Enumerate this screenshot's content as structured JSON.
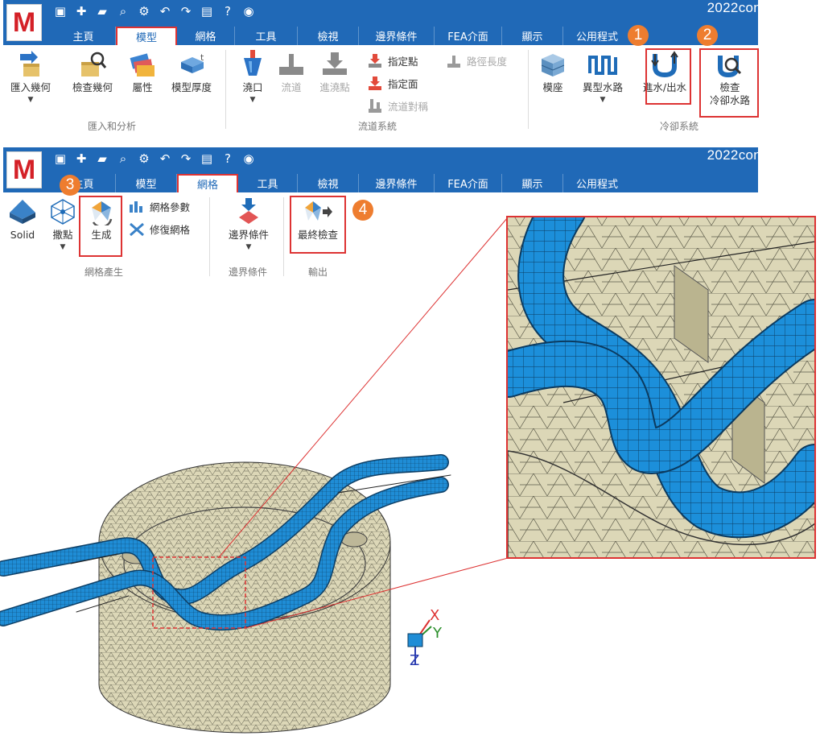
{
  "app": {
    "brand": "2022con",
    "logo_letter": "M"
  },
  "qat_icons": [
    "save-icon",
    "new-icon",
    "open-folder-icon",
    "search-file-icon",
    "gear-icon",
    "undo-icon",
    "redo-icon",
    "help-file-icon",
    "help-icon",
    "camera-icon"
  ],
  "ribbon1": {
    "tabs": [
      "主頁",
      "模型",
      "網格",
      "工具",
      "檢視",
      "邊界條件",
      "FEA介面",
      "顯示",
      "公用程式"
    ],
    "active_tab": "模型",
    "tools": {
      "import_geometry": "匯入幾何",
      "check_geometry": "檢查幾何",
      "attribute": "屬性",
      "model_thickness": "模型厚度",
      "gate": "澆口",
      "runner": "流道",
      "sprue": "進澆點",
      "assign_point": "指定點",
      "assign_face": "指定面",
      "runner_symmetry": "流道對稱",
      "path_length": "路徑長度",
      "mold_base": "模座",
      "special_waterline": "異型水路",
      "inlet_outlet": "進水/出水",
      "check_cooling_1": "檢查",
      "check_cooling_2": "冷卻水路"
    },
    "groups": {
      "import_analysis": "匯入和分析",
      "runner_system": "流道系統",
      "cooling_system": "冷卻系統"
    }
  },
  "ribbon2": {
    "tabs": [
      "主頁",
      "模型",
      "網格",
      "工具",
      "檢視",
      "邊界條件",
      "FEA介面",
      "顯示",
      "公用程式"
    ],
    "active_tab": "網格",
    "tools": {
      "solid": "Solid",
      "seed": "撒點",
      "generate": "生成",
      "mesh_params": "網格參數",
      "repair_mesh": "修復網格",
      "boundary_conditions": "邊界條件",
      "final_check": "最終檢查"
    },
    "groups": {
      "mesh_generation": "網格產生",
      "boundary_conditions": "邊界條件",
      "output": "輸出"
    }
  },
  "badges": [
    "1",
    "2",
    "3",
    "4"
  ],
  "axes": {
    "x": "X",
    "y": "Y",
    "z": "Z"
  },
  "colors": {
    "ribbon_blue": "#2069b7",
    "highlight_red": "#dd3333",
    "badge_orange": "#ee7d2f",
    "mesh_beige": "#dcd7b7",
    "pipe_blue": "#1f8dd6"
  }
}
